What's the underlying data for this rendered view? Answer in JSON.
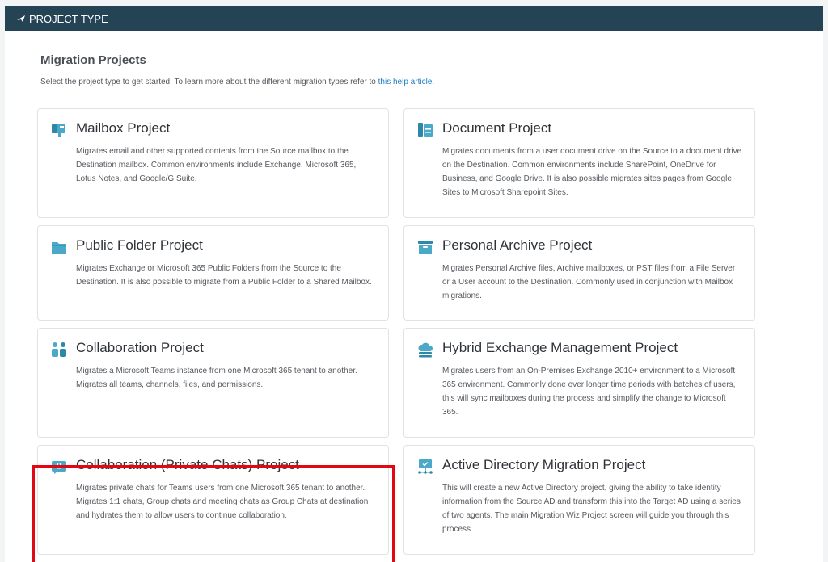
{
  "header": {
    "title": "PROJECT TYPE"
  },
  "main": {
    "title": "Migration Projects",
    "description": "Select the project type to get started. To learn more about the different migration types refer to ",
    "link_text": "this help article.",
    "cards": [
      {
        "title": "Mailbox Project",
        "icon": "mailbox-icon",
        "description": "Migrates email and other supported contents from the Source mailbox to the Destination mailbox. Common environments include Exchange, Microsoft 365, Lotus Notes, and Google/G Suite."
      },
      {
        "title": "Document Project",
        "icon": "document-icon",
        "description": "Migrates documents from a user document drive on the Source to a document drive on the Destination. Common environments include SharePoint, OneDrive for Business, and Google Drive. It is also possible migrates sites pages from Google Sites to Microsoft Sharepoint Sites."
      },
      {
        "title": "Public Folder Project",
        "icon": "folder-icon",
        "description": "Migrates Exchange or Microsoft 365 Public Folders from the Source to the Destination. It is also possible to migrate from a Public Folder to a Shared Mailbox."
      },
      {
        "title": "Personal Archive Project",
        "icon": "archive-icon",
        "description": "Migrates Personal Archive files, Archive mailboxes, or PST files from a File Server or a User account to the Destination. Commonly used in conjunction with Mailbox migrations."
      },
      {
        "title": "Collaboration Project",
        "icon": "users-icon",
        "description": "Migrates a Microsoft Teams instance from one Microsoft 365 tenant to another. Migrates all teams, channels, files, and permissions."
      },
      {
        "title": "Hybrid Exchange Management Project",
        "icon": "cloud-icon",
        "description": "Migrates users from an On-Premises Exchange 2010+ environment to a Microsoft 365 environment. Commonly done over longer time periods with batches of users, this will sync mailboxes during the process and simplify the change to Microsoft 365."
      },
      {
        "title": "Collaboration (Private Chats) Project",
        "icon": "private-chat-icon",
        "description": "Migrates private chats for Teams users from one Microsoft 365 tenant to another. Migrates 1:1 chats, Group chats and meeting chats as Group Chats at destination and hydrates them to allow users to continue collaboration."
      },
      {
        "title": "Active Directory Migration Project",
        "icon": "directory-icon",
        "description": "This will create a new Active Directory project, giving the ability to take identity information from the Source AD and transform this into the Target AD using a series of two agents. The main Migration Wiz Project screen will guide you through this process"
      }
    ]
  },
  "colors": {
    "header_bg": "#244456",
    "icon": "#4aa9c8",
    "link": "#1f7fc1",
    "highlight": "#e30613"
  }
}
